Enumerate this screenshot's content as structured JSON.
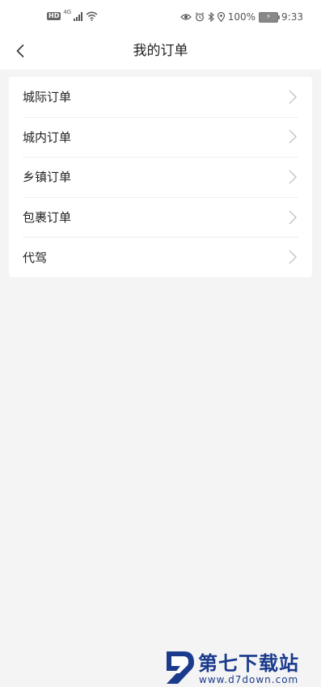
{
  "status_bar": {
    "hd": "HD",
    "network": "4G",
    "battery": "100%",
    "time": "9:33"
  },
  "nav": {
    "title": "我的订单",
    "back_icon": "chevron-left-icon"
  },
  "menu": {
    "items": [
      {
        "label": "城际订单"
      },
      {
        "label": "城内订单"
      },
      {
        "label": "乡镇订单"
      },
      {
        "label": "包裹订单"
      },
      {
        "label": "代驾"
      }
    ],
    "chevron_icon": "chevron-right-icon"
  },
  "watermark": {
    "title": "第七下载站",
    "url": "www.d7down.com",
    "color": "#1a3a8c"
  }
}
